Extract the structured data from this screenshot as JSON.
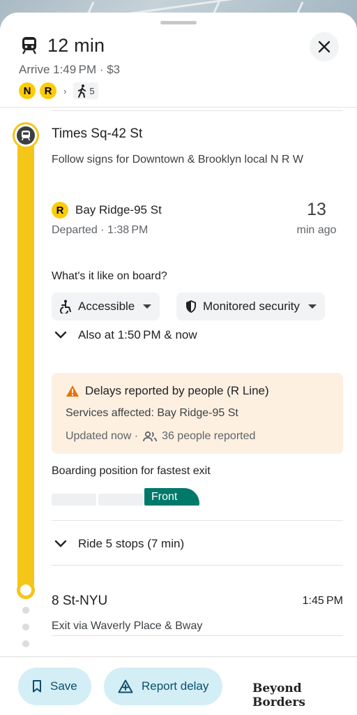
{
  "header": {
    "duration": "12 min",
    "arrive": "Arrive 1:49 PM · $3",
    "lines": [
      "N",
      "R"
    ],
    "walk_minutes": "5"
  },
  "boarding_stop": {
    "name": "Times Sq-42 St",
    "direction": "Follow signs for Downtown & Brooklyn local N R W",
    "line_badge": "R",
    "destination": "Bay Ridge-95 St",
    "departed": "Departed · 1:38 PM",
    "minutes_ago_value": "13",
    "minutes_ago_label": "min ago",
    "question": "What's it like on board?",
    "chips": [
      {
        "label": "Accessible",
        "icon": "accessible-icon"
      },
      {
        "label": "Monitored security",
        "icon": "shield-icon"
      }
    ],
    "also_at": "Also at 1:50 PM & now"
  },
  "alert": {
    "title": "Delays reported by people (R Line)",
    "services": "Services affected: Bay Ridge-95 St",
    "updated": "Updated now ·",
    "reported": "36 people reported",
    "accent_color": "#e8710a",
    "background_color": "#fdf0e1"
  },
  "boarding_position": {
    "label": "Boarding position for fastest exit",
    "front_label": "Front",
    "front_color": "#00796b"
  },
  "ride": {
    "label": "Ride 5 stops (7 min)"
  },
  "destination_stop": {
    "name": "8 St-NYU",
    "time": "1:45 PM",
    "exit": "Exit via Waverly Place & Bway"
  },
  "actions": {
    "save_label": "Save",
    "report_label": "Report delay"
  },
  "colors": {
    "line_yellow": "#fccc0a",
    "route_bar": "#f5c518",
    "action_pill": "#d4eef6"
  },
  "watermark": "Beyond Borders"
}
